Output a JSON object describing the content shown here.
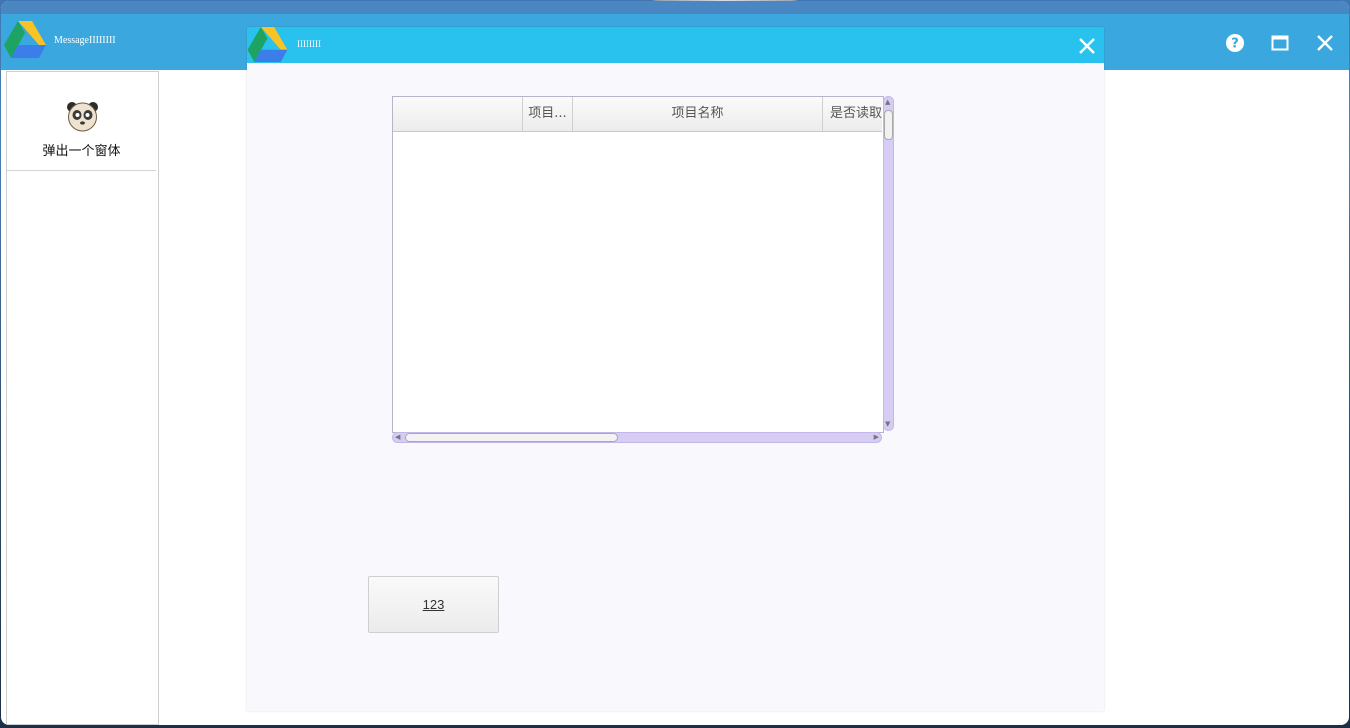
{
  "main_window": {
    "title": "MessageIIIIIIII"
  },
  "sidebar": {
    "items": [
      {
        "label": "弹出一个窗体",
        "icon": "panda-icon"
      }
    ]
  },
  "dialog": {
    "title": "IIIIIIII",
    "grid": {
      "columns": [
        "",
        "项目...",
        "项目名称",
        "是否读取"
      ],
      "rows": []
    },
    "button_label": "123"
  },
  "colors": {
    "main_titlebar": "#3aa8de",
    "dialog_titlebar": "#29c2ee",
    "scrollbar": "#d6ccf4"
  }
}
